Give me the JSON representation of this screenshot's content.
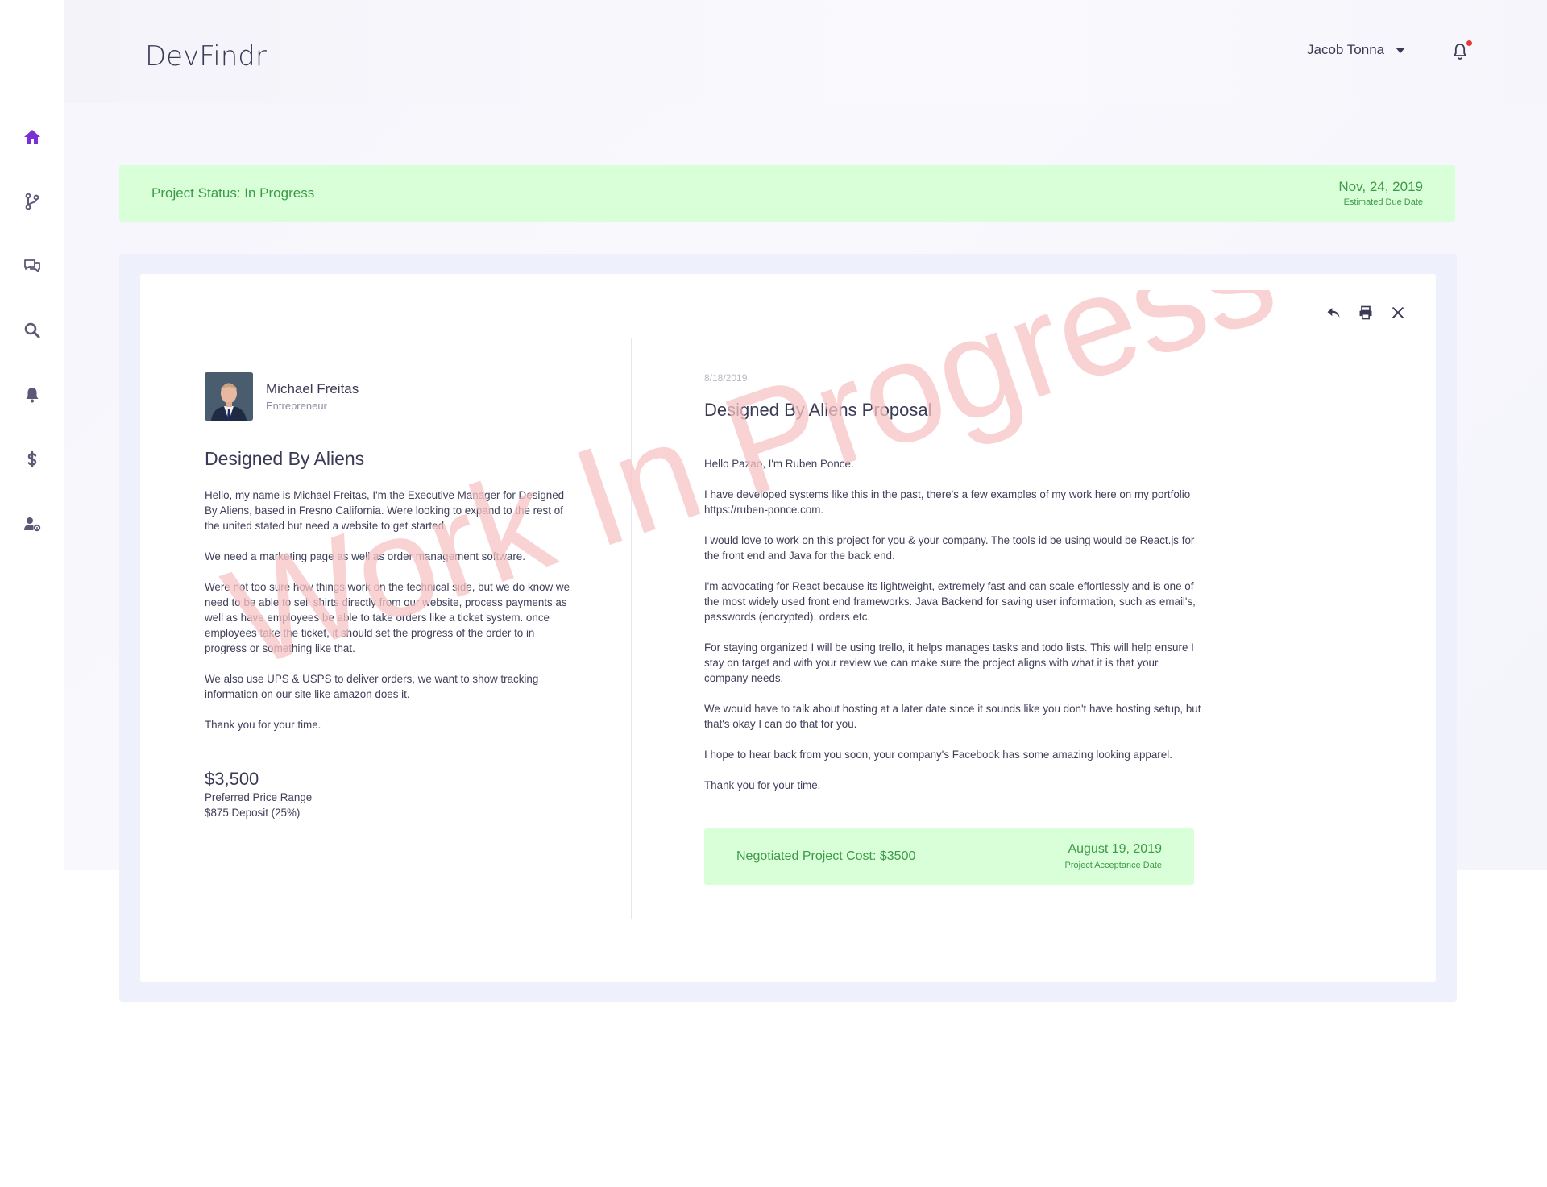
{
  "app": {
    "brand": "DevFindr"
  },
  "header": {
    "user_name": "Jacob Tonna"
  },
  "sidebar": {
    "items": [
      {
        "icon": "home-icon",
        "active": true
      },
      {
        "icon": "git-branch-icon"
      },
      {
        "icon": "chat-icon"
      },
      {
        "icon": "search-icon"
      },
      {
        "icon": "bell-icon"
      },
      {
        "icon": "dollar-icon"
      },
      {
        "icon": "user-settings-icon"
      }
    ]
  },
  "status": {
    "text": "Project Status: In Progress",
    "due_date": "Nov, 24, 2019",
    "due_label": "Estimated Due Date"
  },
  "watermark": "Work In Progress",
  "client": {
    "name": "Michael Freitas",
    "role": "Entrepreneur",
    "title": "Designed By Aliens",
    "paragraphs": [
      "Hello, my name is Michael Freitas, I'm the Executive Manager for Designed By Aliens, based in Fresno California. Were looking to expand to the rest of the united stated but need a website to get started.",
      "We need a marketing page as well as order management software.",
      "Were not too sure how things work on the technical side, but we do know we need to be able to sell shirts directly from our website, process payments as well as have employees be able to take orders like a ticket system. once employees take the ticket, it should set the progress of the order to in progress or something like that.",
      "We also use UPS & USPS to deliver orders, we want to show tracking information on our site like amazon does it.",
      "Thank you for your time."
    ],
    "price": "$3,500",
    "price_label": "Preferred Price Range",
    "deposit": "$875 Deposit (25%)"
  },
  "proposal": {
    "date": "8/18/2019",
    "title": "Designed By Aliens Proposal",
    "paragraphs": [
      "Hello Pazao, I'm Ruben Ponce.",
      "I have developed systems like this in the past, there's a few examples of my work here on my portfolio https://ruben-ponce.com.",
      "I would love to work on this project for you & your company. The tools id be using would be React.js for the front end and Java for the back end.",
      "I'm advocating for React because its lightweight, extremely fast and can scale effortlessly and is one of the most widely used front end frameworks. Java Backend for saving user information, such as email's, passwords (encrypted), orders etc.",
      "For staying organized I will be using trello, it helps manages tasks and todo lists. This will help ensure I stay on target and with your review we can make sure the project aligns with what it is that your company needs.",
      "We would have to talk about hosting at a later date since it sounds like you don't have hosting setup, but that's okay I can do that for you.",
      "I hope to hear back from you soon, your company's Facebook has some amazing looking apparel.",
      "Thank you for your time."
    ],
    "cost_text": "Negotiated Project Cost: $3500",
    "accept_date": "August 19, 2019",
    "accept_label": "Project Acceptance Date"
  },
  "colors": {
    "accent": "#7b2fd6",
    "nav_icon": "#5a5a78",
    "success_bg": "#d9ffd9",
    "success_text": "#3e9a48",
    "watermark": "#f7c9c9"
  }
}
